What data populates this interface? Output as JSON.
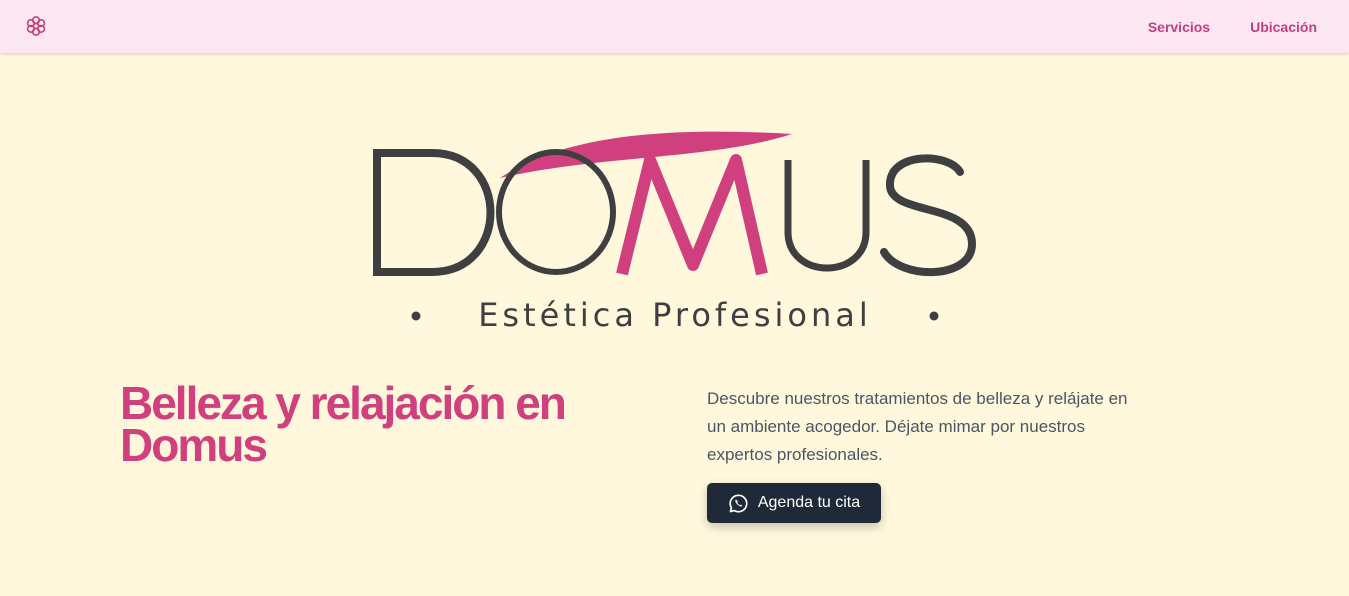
{
  "navbar": {
    "logo_icon": "flower-icon",
    "links": [
      {
        "label": "Servicios"
      },
      {
        "label": "Ubicación"
      }
    ]
  },
  "logo": {
    "wordmark": "DOMUS",
    "tagline": "Estética Profesional"
  },
  "hero": {
    "headline": "Belleza y relajación en Domus",
    "description": "Descubre nuestros tratamientos de belleza y relájate en un ambiente acogedor. Déjate mimar por nuestros expertos profesionales.",
    "cta_label": "Agenda tu cita",
    "cta_icon": "whatsapp-icon"
  },
  "colors": {
    "background": "#fff8dc",
    "navbar_background": "#fce7f3",
    "accent_pink": "#d0407f",
    "logo_gray": "#3f3f42",
    "button_dark": "#1f2937",
    "body_text": "#4b5563"
  }
}
